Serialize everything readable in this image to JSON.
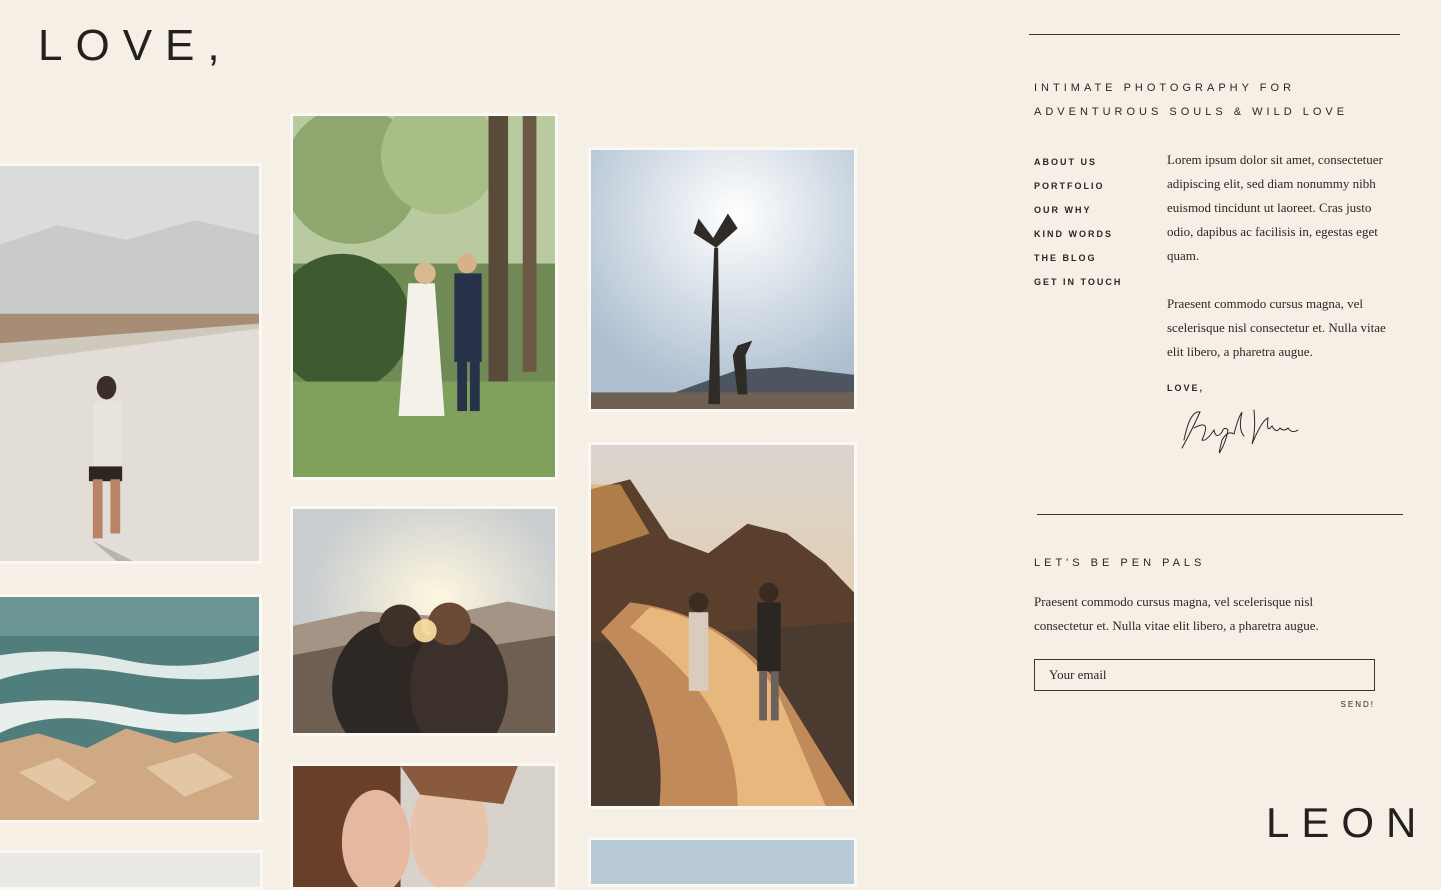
{
  "brand": {
    "top": "LOVE,",
    "bottom": "LEON"
  },
  "tagline": {
    "line1": "INTIMATE PHOTOGRAPHY FOR",
    "line2": "ADVENTUROUS SOULS & WILD LOVE"
  },
  "nav": [
    {
      "label": "ABOUT US"
    },
    {
      "label": "PORTFOLIO"
    },
    {
      "label": "OUR WHY"
    },
    {
      "label": "KIND WORDS"
    },
    {
      "label": "THE BLOG"
    },
    {
      "label": "GET IN TOUCH"
    }
  ],
  "bio": {
    "p1": "Lorem ipsum dolor sit amet, consectetuer adipiscing elit, sed diam nonummy nibh euismod tincidunt ut laoreet. Cras justo odio, dapibus ac facilisis in, egestas eget quam.",
    "p2": "Praesent commodo cursus magna, vel scelerisque nisl consectetur et. Nulla vitae elit libero, a pharetra augue.",
    "signoff": "LOVE,",
    "signature": "Kaleigh Moore"
  },
  "newsletter": {
    "title": "LET'S BE PEN PALS",
    "text": "Praesent commodo cursus magna, vel scelerisque nisl consectetur et. Nulla vitae elit libero, a pharetra augue.",
    "placeholder": "Your email",
    "send": "SEND!"
  }
}
